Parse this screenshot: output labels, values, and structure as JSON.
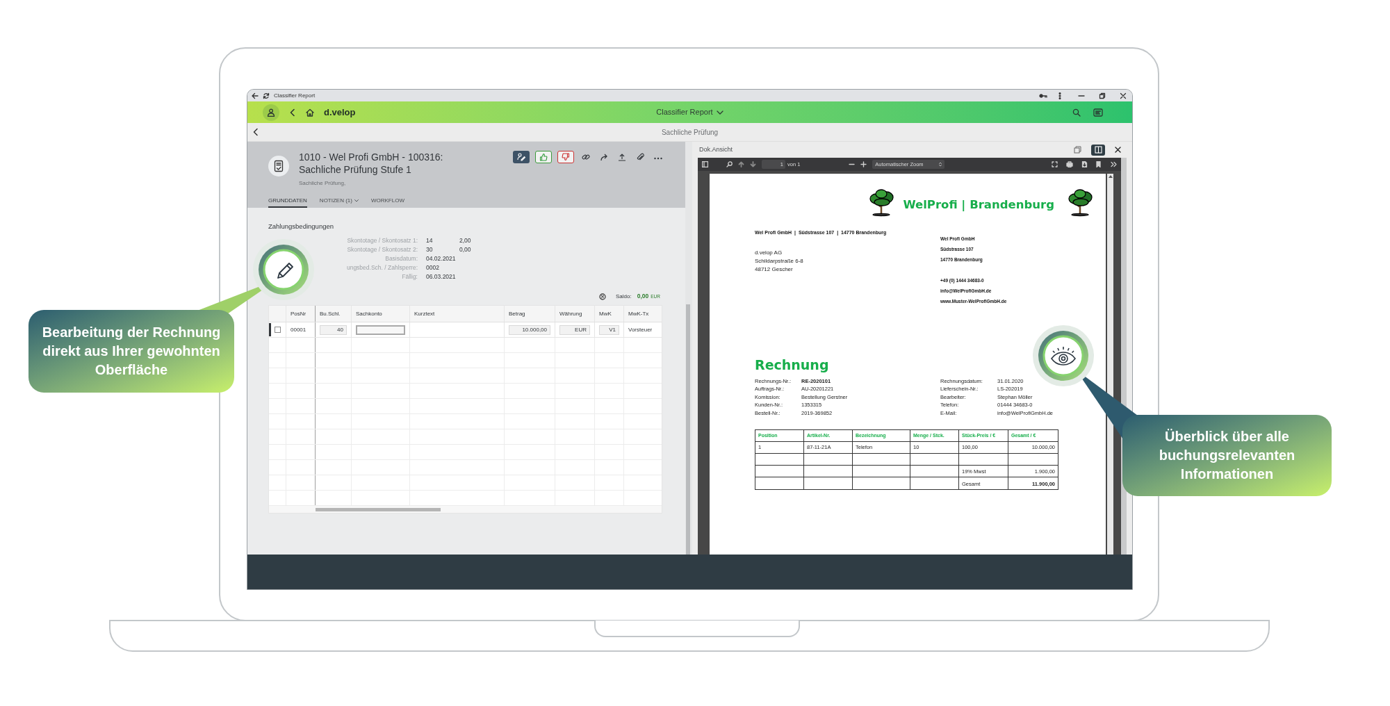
{
  "browser_bar": {
    "title": "Classifier Report"
  },
  "app_bar": {
    "brand": "d.velop",
    "title": "Classifier Report"
  },
  "sub_bar": {
    "title": "Sachliche Prüfung"
  },
  "task": {
    "title": [
      "1010 - Wel Profi GmbH - 100316:",
      "Sachliche Prüfung Stufe 1"
    ],
    "subtitle": "Sachliche Prüfung,",
    "actions": [
      {
        "kind": "edit"
      },
      {
        "kind": "approve"
      },
      {
        "kind": "reject"
      },
      {
        "kind": "link"
      },
      {
        "kind": "forward"
      },
      {
        "kind": "upload"
      },
      {
        "kind": "attach"
      },
      {
        "kind": "more"
      }
    ]
  },
  "tabs": [
    {
      "label": "GRUNDDATEN",
      "selected": true,
      "has_menu": false
    },
    {
      "label": "NOTIZEN (1)",
      "selected": false,
      "has_menu": true
    },
    {
      "label": "WORKFLOW",
      "selected": false,
      "has_menu": false
    }
  ],
  "payment_terms": {
    "heading": "Zahlungsbedingungen",
    "rows": [
      {
        "label": "Skontotage / Skontosatz 1:",
        "value": "14",
        "extra": "2,00"
      },
      {
        "label": "Skontotage / Skontosatz 2:",
        "value": "30",
        "extra": "0,00"
      },
      {
        "label": "Basisdatum:",
        "value": "04.02.2021"
      },
      {
        "label": "ungsbed.Sch. / Zahlsperre:",
        "value": "0002"
      },
      {
        "label": "Fällig:",
        "value": "06.03.2021"
      }
    ]
  },
  "saldo": {
    "label": "Saldo:",
    "amount": "0,00",
    "currency": "EUR"
  },
  "line_items": {
    "columns": [
      "PosNr",
      "Bu.Schl.",
      "Sachkonto",
      "Kurztext",
      "Betrag",
      "Währung",
      "MwK",
      "MwK-Tx"
    ],
    "rows": [
      {
        "selected": true,
        "checked": false,
        "cells": [
          {
            "kind": "text",
            "value": "00001"
          },
          {
            "kind": "field",
            "value": "40"
          },
          {
            "kind": "input"
          },
          {
            "kind": "blank"
          },
          {
            "kind": "field",
            "value": "10.000,00"
          },
          {
            "kind": "field",
            "value": "EUR"
          },
          {
            "kind": "field",
            "value": "V1"
          },
          {
            "kind": "text",
            "value": "Vorsteuer"
          }
        ]
      }
    ]
  },
  "document_view": {
    "title": "Dok.Ansicht",
    "view_modes": [
      {
        "kind": "window",
        "selected": false
      },
      {
        "kind": "split",
        "selected": true
      }
    ],
    "viewer": {
      "page": "1",
      "page_count": "von 1",
      "zoom": "Automatischer Zoom"
    },
    "invoice": {
      "brand": "WelProfi | Brandenburg",
      "sender_line": "Wel Profi GmbH  |  Südstrasse 107  |  14770 Brandenburg",
      "recipient": [
        "d.velop AG",
        "Schildarpstraße 6-8",
        "48712 Gescher"
      ],
      "company": [
        "Wel Profi GmbH",
        "Südstrasse 107",
        "14770 Brandenburg"
      ],
      "contact": [
        "+49 (0) 1444 34683-0",
        "info@WelProfiGmbH.de",
        "www.Muster-WelProfiGmbH.de"
      ],
      "title": "Rechnung",
      "details_left": [
        {
          "label": "Rechnungs-Nr.:",
          "value": "RE-2020101",
          "bold": true
        },
        {
          "label": "Auftrags-Nr.:",
          "value": "AU-20201221",
          "bold": false
        },
        {
          "label": "Komission:",
          "value": "Bestellung Gerstner",
          "bold": false
        },
        {
          "label": "Kunden-Nr.:",
          "value": "1353315",
          "bold": false
        },
        {
          "label": "Bestell-Nr.:",
          "value": "2019-369852",
          "bold": false
        }
      ],
      "details_right": [
        {
          "label": "Rechnungsdatum:",
          "value": "31.01.2020",
          "bold": false
        },
        {
          "label": "Lieferschein-Nr.:",
          "value": "LS-202019",
          "bold": false
        },
        {
          "label": "Bearbeiter:",
          "value": "Stephan Möller",
          "bold": false
        },
        {
          "label": "Telefon:",
          "value": "01444 34683-0",
          "bold": false
        },
        {
          "label": "E-Mail:",
          "value": "info@WelProfiGmbH.de",
          "bold": false
        }
      ],
      "table": {
        "columns": [
          "Position",
          "Artikel-Nr.",
          "Bezeichnung",
          "Menge / Stck.",
          "Stück-Preis / €",
          "Gesamt / €"
        ],
        "rows": [
          [
            "1",
            "87-11-21A",
            "Telefon",
            "10",
            "100,00",
            "10.000,00"
          ]
        ],
        "totals": [
          {
            "label": "19% Mwst",
            "value": "1.900,00",
            "bold": false
          },
          {
            "label": "Gesamt",
            "value": "11.900,00",
            "bold": true
          }
        ]
      }
    }
  },
  "callouts": [
    {
      "kind": "edit",
      "text": "Bearbeitung der Rechnung direkt aus Ihrer gewohnten Oberfläche"
    },
    {
      "kind": "view",
      "text": "Überblick über alle buchungsrelevanten Informationen"
    }
  ]
}
